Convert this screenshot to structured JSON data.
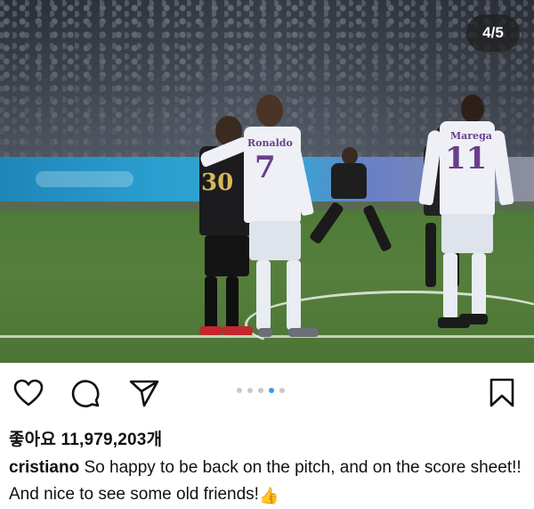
{
  "post": {
    "image_counter": "4/5",
    "carousel": {
      "total": 5,
      "active_index": 3
    },
    "players": [
      {
        "number": "30",
        "kit": "dark"
      },
      {
        "number": "7",
        "name": "Ronaldo",
        "kit": "white"
      },
      {
        "number": "11",
        "name": "Marega",
        "kit": "white"
      }
    ]
  },
  "actions": {
    "like_icon": "heart-icon",
    "comment_icon": "comment-bubble-icon",
    "share_icon": "send-icon",
    "save_icon": "bookmark-icon"
  },
  "likes": {
    "label": "좋아요",
    "count": "11,979,203",
    "suffix": "개"
  },
  "caption": {
    "username": "cristiano",
    "text": "So happy to be back on the pitch, and on the score sheet!! And nice to see some old friends!",
    "emoji": "👍"
  },
  "colors": {
    "accent": "#3897f0",
    "text": "#111111",
    "dot_inactive": "#c8c8c8"
  }
}
